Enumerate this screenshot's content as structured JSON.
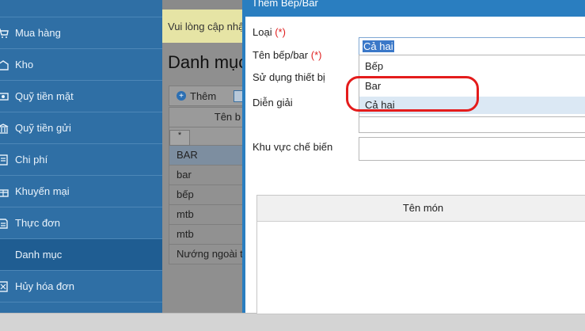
{
  "sidebar": {
    "items": [
      {
        "label": "Mua hàng",
        "icon": "cart-icon"
      },
      {
        "label": "Kho",
        "icon": "warehouse-icon"
      },
      {
        "label": "Quỹ tiền mặt",
        "icon": "cash-icon"
      },
      {
        "label": "Quỹ tiền gửi",
        "icon": "bank-icon"
      },
      {
        "label": "Chi phí",
        "icon": "expense-icon"
      },
      {
        "label": "Khuyến mại",
        "icon": "gift-icon"
      },
      {
        "label": "Thực đơn",
        "icon": "menu-book-icon"
      },
      {
        "label": "Danh mục",
        "icon": "category-icon"
      },
      {
        "label": "Hủy hóa đơn",
        "icon": "cancel-invoice-icon"
      }
    ],
    "active": "Danh mục"
  },
  "background_page": {
    "notice": "Vui lòng cập nhật",
    "title": "Danh mục",
    "toolbar": {
      "add_label": "Thêm"
    },
    "grid": {
      "header": "Tên b",
      "filter_symbol": "*",
      "rows": [
        "BAR",
        "bar",
        "bếp",
        "mtb",
        "mtb",
        "Nướng ngoài trời"
      ]
    }
  },
  "dialog": {
    "title": "Thêm Bếp/Bar",
    "fields": {
      "loai": {
        "label": "Loại",
        "required": "(*)",
        "value": "Cả hai"
      },
      "ten": {
        "label": "Tên bếp/bar",
        "required": "(*)"
      },
      "thiet_bi": {
        "label": "Sử dụng thiết bị"
      },
      "dien_giai": {
        "label": "Diễn giải"
      },
      "khu_vuc": {
        "label": "Khu vực chế biến"
      }
    },
    "dropdown_options": [
      "Bếp",
      "Bar",
      "Cả hai"
    ],
    "highlighted_option": "Cả hai",
    "table": {
      "column": "Tên món"
    }
  },
  "colors": {
    "sidebar": "#2f6fa5",
    "dialog_accent": "#2a7ec0",
    "annotation": "#e41c1c",
    "required": "#e02020"
  }
}
